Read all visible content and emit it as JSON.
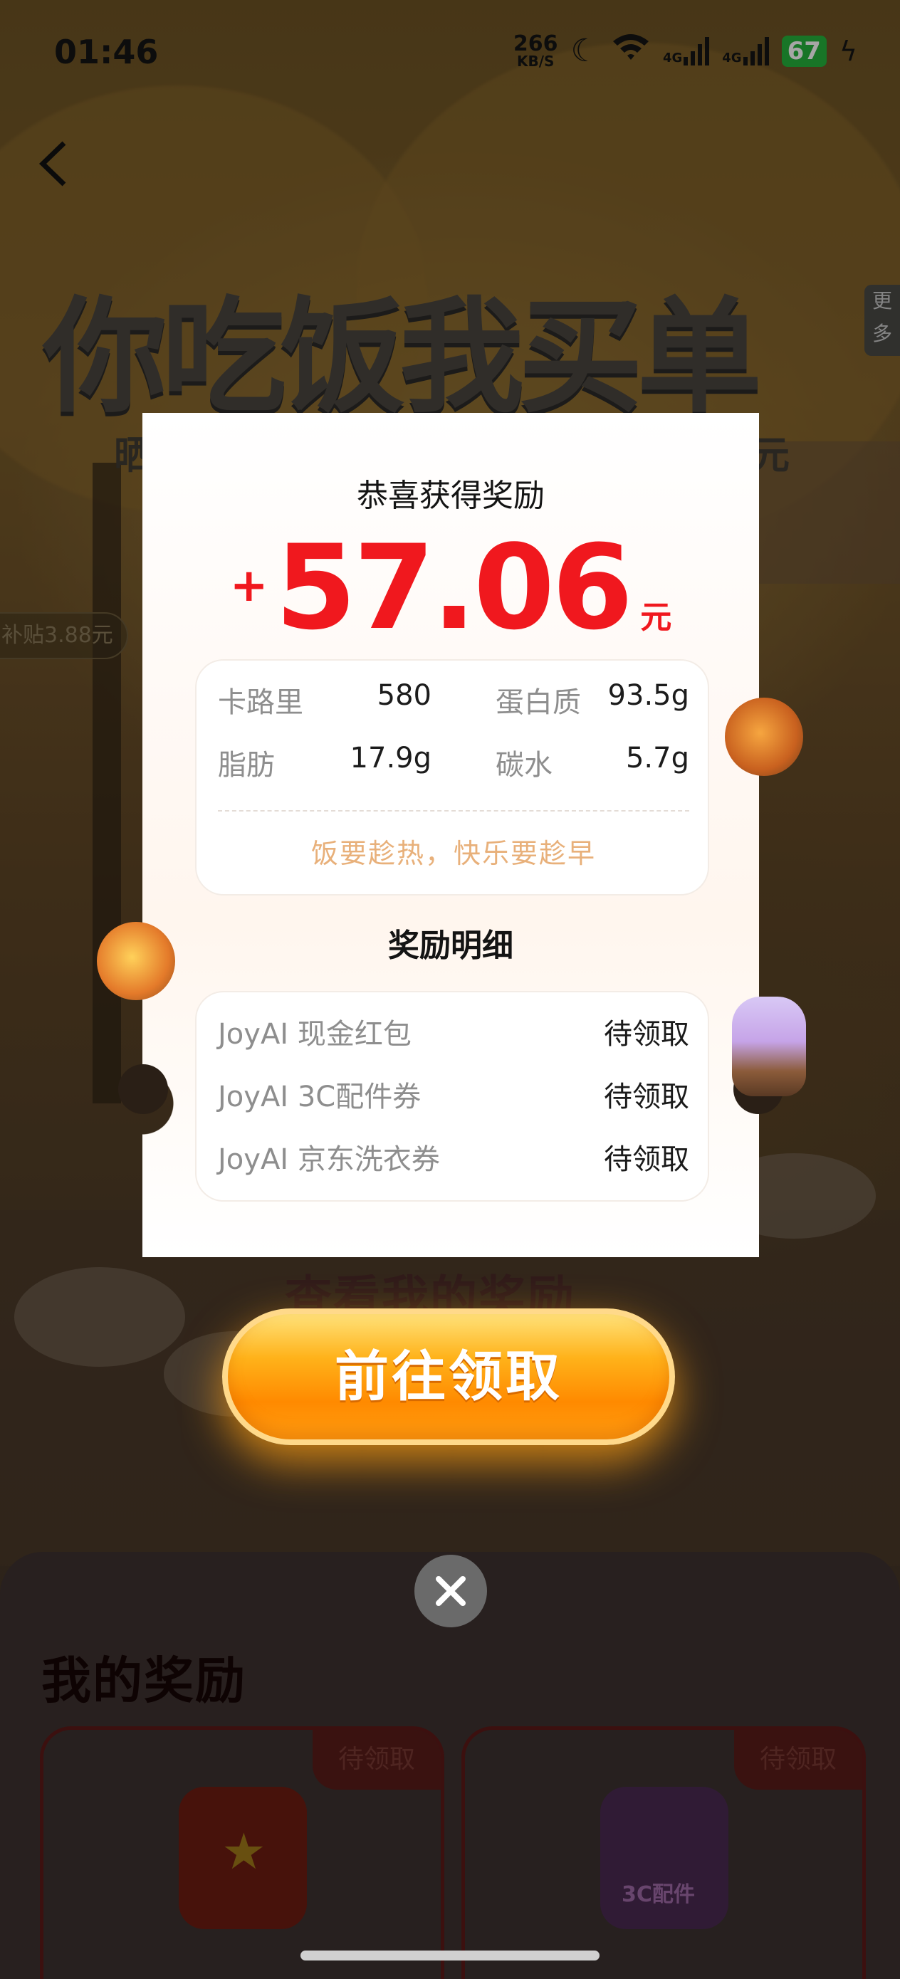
{
  "status_bar": {
    "time": "01:46",
    "net_speed_value": "266",
    "net_speed_unit": "KB/S",
    "signal1": "4G",
    "signal2": "4G",
    "battery": "67"
  },
  "background": {
    "back_icon": "chevron-left-icon",
    "hero_title": "你吃饭我买单",
    "more_label": "更多",
    "subtitle_left": "晒",
    "subtitle_right": "元",
    "subsidy_pill": "补贴3.88元",
    "view_rewards_label": "查看我的奖励",
    "my_rewards_title": "我的奖励",
    "reward_cards": [
      {
        "tag": "待领取",
        "icon": "star-coupon-icon"
      },
      {
        "tag": "待领取",
        "icon": "earbuds-icon",
        "caption": "3C配件"
      }
    ]
  },
  "modal": {
    "congrats": "恭喜获得奖励",
    "amount_sign": "+",
    "amount": "57.06",
    "amount_unit": "元",
    "nutrition": {
      "calories_label": "卡路里",
      "calories_value": "580",
      "protein_label": "蛋白质",
      "protein_value": "93.5g",
      "fat_label": "脂肪",
      "fat_value": "17.9g",
      "carbs_label": "碳水",
      "carbs_value": "5.7g"
    },
    "slogan": "饭要趁热，快乐要趁早",
    "detail_title": "奖励明细",
    "details": [
      {
        "name": "JoyAI 现金红包",
        "status": "待领取"
      },
      {
        "name": "JoyAI 3C配件券",
        "status": "待领取"
      },
      {
        "name": "JoyAI 京东洗衣券",
        "status": "待领取"
      }
    ],
    "claim_button": "前往领取",
    "close_icon": "close-icon"
  },
  "colors": {
    "amount_red": "#f0181e",
    "slogan_orange": "#e8b07a",
    "claim_orange": "#ff9d10",
    "battery_green": "#26b43c"
  }
}
